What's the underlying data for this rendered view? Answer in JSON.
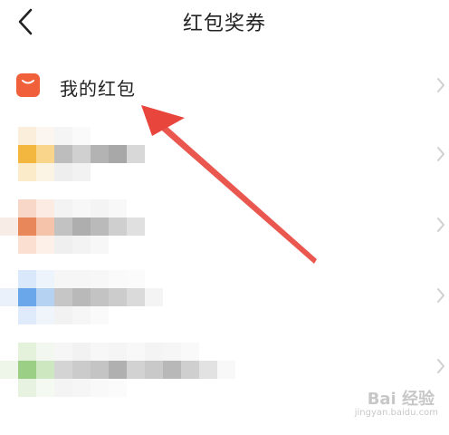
{
  "header": {
    "title": "红包奖券"
  },
  "icons": {
    "back": "chevron-left-icon",
    "row_chevron": "chevron-right-icon",
    "wallet": "red-packet-icon"
  },
  "rows": [
    {
      "label": "我的红包",
      "icon_color": "#f0603a"
    },
    {
      "label": "",
      "icon_color": "#f3b63f"
    },
    {
      "label": "",
      "icon_color": "#e8875a"
    },
    {
      "label": "",
      "icon_color": "#6aa6ea"
    },
    {
      "label": "",
      "icon_color": "#9ccf86"
    }
  ],
  "colors": {
    "annotation_arrow": "#e8453c",
    "chevron": "#c8c8c8"
  },
  "watermark": {
    "main": "Bai 经验",
    "sub": "jingyan.baidu.com"
  }
}
